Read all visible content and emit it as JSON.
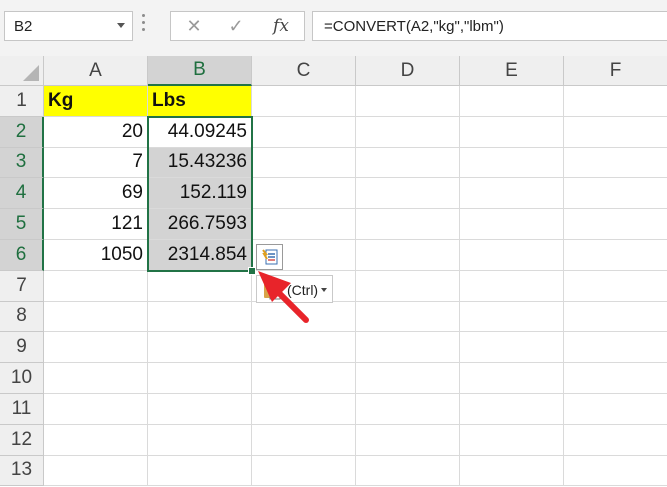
{
  "namebox": {
    "value": "B2"
  },
  "formula_bar": {
    "cancel_icon": "close-icon",
    "enter_icon": "check-icon",
    "fx_label": "fx",
    "formula": "=CONVERT(A2,\"kg\",\"lbm\")"
  },
  "columns": [
    "A",
    "B",
    "C",
    "D",
    "E",
    "F"
  ],
  "rows": [
    "1",
    "2",
    "3",
    "4",
    "5",
    "6",
    "7",
    "8",
    "9",
    "10",
    "11",
    "12",
    "13"
  ],
  "selected_cell": "B2",
  "selected_range": "B2:B6",
  "cells": {
    "A1": "Kg",
    "B1": "Lbs",
    "A2": "20",
    "B2": "44.09245",
    "A3": "7",
    "B3": "15.43236",
    "A4": "69",
    "B4": "152.119",
    "A5": "121",
    "B5": "266.7593",
    "A6": "1050",
    "B6": "2314.854"
  },
  "paste_options": {
    "label": "(Ctrl)",
    "icon": "paste-options-icon"
  },
  "annotation": {
    "arrow_color": "#e8242a"
  },
  "colors": {
    "accent": "#217346",
    "header_highlight": "#ffff00",
    "selection_fill": "#d3d3d3"
  }
}
